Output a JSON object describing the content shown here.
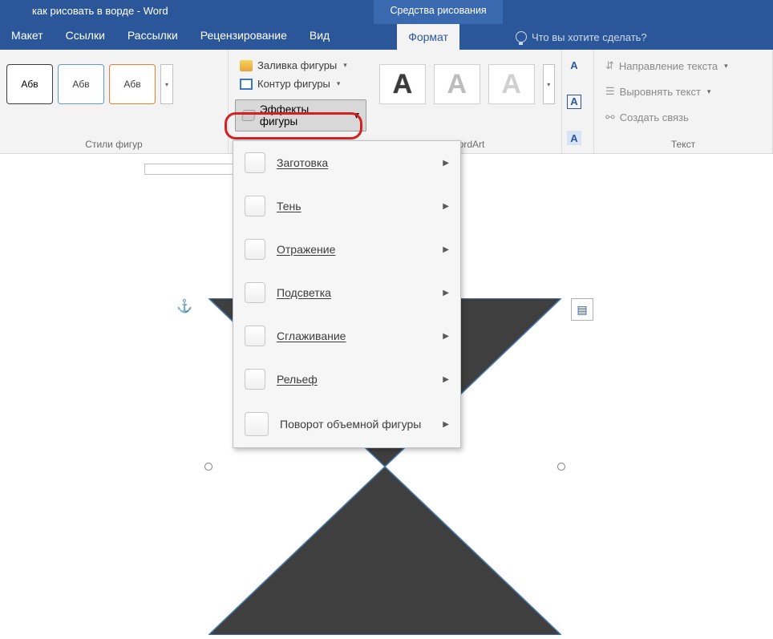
{
  "title": "как рисовать в ворде - Word",
  "drawing_tools_tab": "Средства рисования",
  "tabs": {
    "layout": "Макет",
    "links": "Ссылки",
    "mailings": "Рассылки",
    "review": "Рецензирование",
    "view": "Вид",
    "format": "Формат"
  },
  "tell_me": "Что вы хотите сделать?",
  "group_labels": {
    "shape_styles": "Стили фигур",
    "wordart": "WordArt",
    "text": "Текст"
  },
  "style_thumb_text": "Абв",
  "fill": "Заливка фигуры",
  "outline": "Контур фигуры",
  "effects": "Эффекты фигуры",
  "wordart_glyph": "А",
  "text_group": {
    "direction": "Направление текста",
    "align": "Выровнять текст",
    "link": "Создать связь"
  },
  "dropdown": {
    "preset": "Заготовка",
    "shadow": "Тень",
    "reflection": "Отражение",
    "glow": "Подсветка",
    "soft": "Сглаживание",
    "bevel": "Рельеф",
    "rotation": "Поворот объемной фигуры"
  }
}
